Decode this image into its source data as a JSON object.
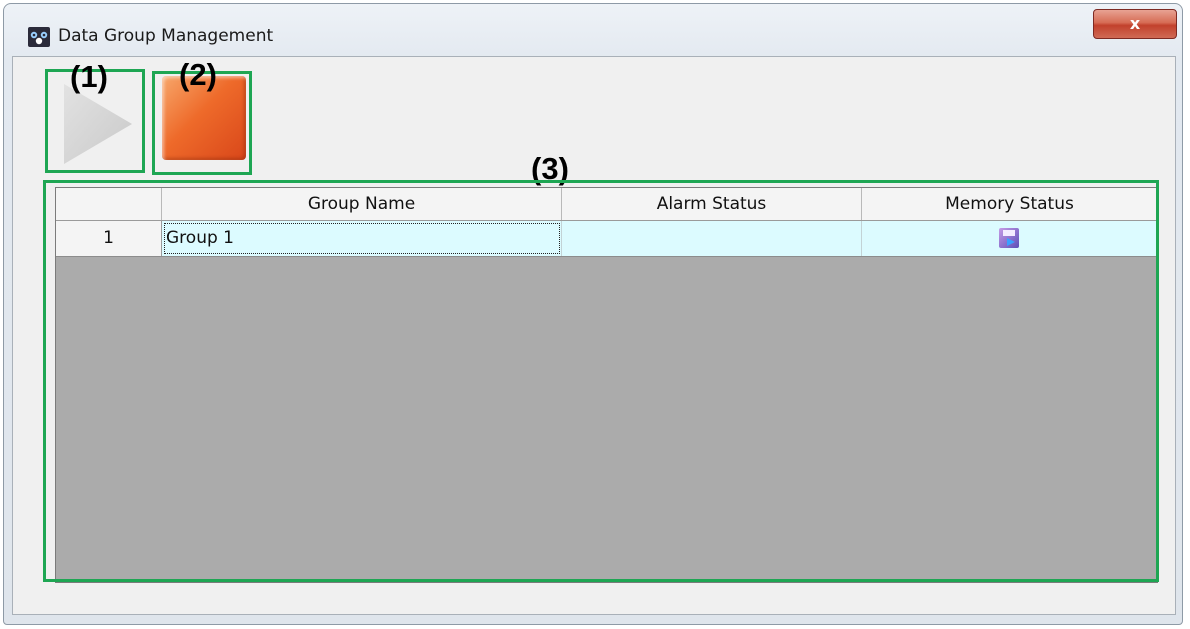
{
  "window": {
    "title": "Data Group Management",
    "close_label": "x"
  },
  "toolbar": {
    "play_icon": "play-icon",
    "stop_icon": "stop-icon"
  },
  "callouts": [
    "(1)",
    "(2)",
    "(3)"
  ],
  "grid": {
    "columns": [
      "Group Name",
      "Alarm Status",
      "Memory Status"
    ],
    "rows": [
      {
        "row_number": "1",
        "group_name": "Group 1",
        "alarm_status": "",
        "memory_status_icon": "save-to-memory-icon"
      }
    ]
  },
  "colors": {
    "highlight": "#1ea653",
    "row_background": "#dcfbff",
    "empty_grid": "#ababab",
    "stop_button": "#ee6a2a"
  }
}
